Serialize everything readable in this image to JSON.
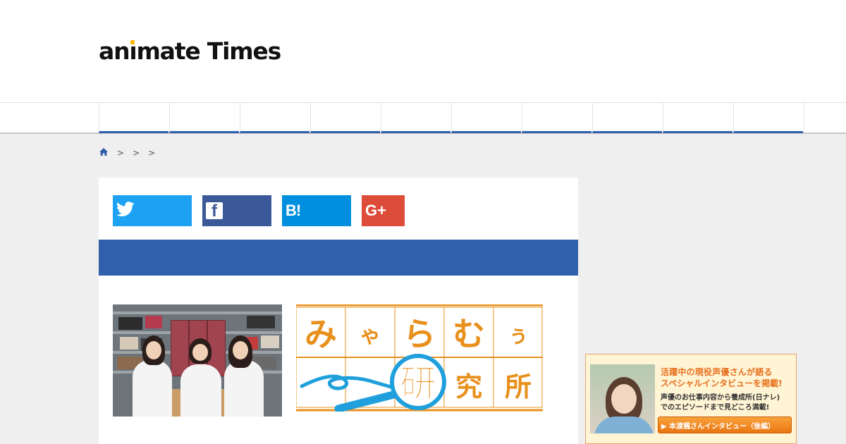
{
  "header": {
    "logo_text": "animate Times",
    "logo_accent_color": "#f5b800"
  },
  "nav": {
    "item_count": 10,
    "accent_color": "#3060b0"
  },
  "breadcrumb": {
    "home_icon": "home-icon",
    "separators": [
      ">",
      ">",
      ">"
    ]
  },
  "share": {
    "twitter": {
      "icon": "twitter-icon",
      "color": "#1da1f2"
    },
    "facebook": {
      "icon": "facebook-icon",
      "color": "#3b5998",
      "glyph": "f"
    },
    "hatena": {
      "icon": "hatena-bookmark-icon",
      "color": "#008fde",
      "glyph": "B!"
    },
    "googleplus": {
      "icon": "google-plus-icon",
      "color": "#dd4b39",
      "glyph": "G+"
    }
  },
  "article": {
    "header_bar_color": "#3060ac",
    "lab_logo": {
      "row1": [
        "み",
        "ゃ",
        "ら",
        "む",
        "ぅ"
      ],
      "row2": [
        "研",
        "究",
        "所"
      ],
      "color": "#e8901c",
      "accent": "#1fa0dc"
    }
  },
  "ad": {
    "line1": "活躍中の現役声優さんが語る",
    "line2": "スペシャルインタビューを掲載!",
    "line3": "声優のお仕事内容から養成所(日ナレ)",
    "line4": "でのエピソードまで見どころ満載!",
    "button": "▶ 本渡楓さんインタビュー（後編）"
  }
}
